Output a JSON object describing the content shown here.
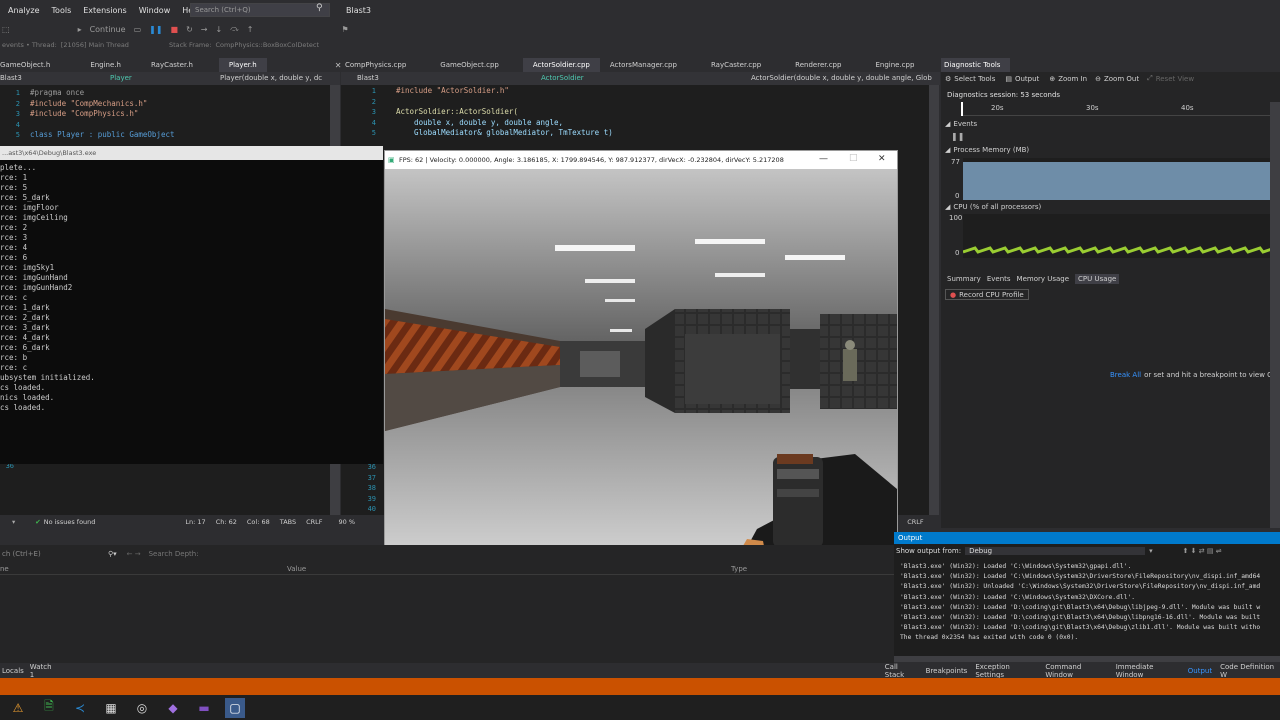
{
  "menu": {
    "items": [
      "Analyze",
      "Tools",
      "Extensions",
      "Window",
      "Help"
    ],
    "search_placeholder": "Search (Ctrl+Q)",
    "solution": "Blast3"
  },
  "toolbar": {
    "continue": "Continue",
    "thread_label": "events • Thread:",
    "thread": "[21056] Main Thread",
    "stack_frame_label": "Stack Frame:",
    "stack_frame": "CompPhysics::BoxBoxColDetect"
  },
  "left_editor": {
    "tabs": [
      "GameObject.h",
      "Engine.h",
      "RayCaster.h",
      "Player.h"
    ],
    "nav_project": "Blast3",
    "nav_class": "Player",
    "nav_member": "Player(double x, double y, dc",
    "lines": [
      {
        "n": "1",
        "t": "#pragma once"
      },
      {
        "n": "2",
        "t": "#include \"CompMechanics.h\""
      },
      {
        "n": "3",
        "t": "#include \"CompPhysics.h\""
      },
      {
        "n": "4",
        "t": ""
      },
      {
        "n": "5",
        "t": "class Player : public GameObject"
      }
    ],
    "bottom_lines": [
      "36"
    ]
  },
  "right_editor": {
    "tabs": [
      "CompPhysics.cpp",
      "GameObject.cpp",
      "ActorSoldier.cpp",
      "ActorsManager.cpp",
      "RayCaster.cpp",
      "Renderer.cpp",
      "Engine.cpp"
    ],
    "nav_project": "Blast3",
    "nav_class": "ActorSoldier",
    "nav_member": "ActorSoldier(double x, double y, double angle, Glob",
    "lines": [
      {
        "n": "1",
        "t": "#include \"ActorSoldier.h\""
      },
      {
        "n": "2",
        "t": ""
      },
      {
        "n": "3",
        "t": "ActorSoldier::ActorSoldier("
      },
      {
        "n": "4",
        "t": "    double x, double y, double angle,"
      },
      {
        "n": "5",
        "t": "    GlobalMediator& globalMediator, TmTexture t)"
      }
    ],
    "bottom_lines": [
      "36",
      "37",
      "38",
      "39",
      "40"
    ]
  },
  "console": {
    "title": "...ast3\\x64\\Debug\\Blast3.exe",
    "lines": [
      "plete...",
      "rce: 1",
      "rce: 5",
      "rce: 5_dark",
      "rce: imgFloor",
      "rce: imgCeiling",
      "rce: 2",
      "rce: 3",
      "rce: 4",
      "rce: 6",
      "rce: imgSky1",
      "rce: imgGunHand",
      "rce: imgGunHand2",
      "rce: c",
      "rce: 1_dark",
      "rce: 2_dark",
      "rce: 3_dark",
      "rce: 4_dark",
      "rce: 6_dark",
      "rce: b",
      "rce: c",
      "ubsystem initialized.",
      "cs loaded.",
      "nics loaded.",
      "cs loaded."
    ]
  },
  "game_window": {
    "title": "FPS: 62 | Velocity: 0.000000, Angle: 3.186185, X: 1799.894546, Y: 987.912377, dirVecX: -0.232804, dirVecY: 5.217208",
    "minimize": "—",
    "maximize": "□",
    "close": "✕"
  },
  "status": {
    "no_issues": "No issues found",
    "ln": "Ln: 17",
    "ch": "Ch: 62",
    "col": "Col: 68",
    "tabs": "TABS",
    "crlf": "CRLF",
    "zoom": "90 %",
    "crlf_right": "CRLF",
    "s_right": "S"
  },
  "diagnostics": {
    "title": "Diagnostic Tools",
    "select_tools": "Select Tools",
    "output": "Output",
    "zoom_in": "Zoom In",
    "zoom_out": "Zoom Out",
    "reset_view": "Reset View",
    "session": "Diagnostics session: 53 seconds",
    "ticks": [
      "20s",
      "30s",
      "40s"
    ],
    "events": "Events",
    "process_memory": "Process Memory (MB)",
    "mem_max": "77",
    "mem_min": "0",
    "cpu_title": "CPU (% of all processors)",
    "cpu_max": "100",
    "cpu_min": "0",
    "tabs": [
      "Summary",
      "Events",
      "Memory Usage",
      "CPU Usage"
    ],
    "record": "Record CPU Profile",
    "break_all": "Break All",
    "hint": "or set and hit a breakpoint to view CPU Us"
  },
  "watch": {
    "search_placeholder": "ch (Ctrl+E)",
    "search_depth": "Search Depth:",
    "col_name": "ne",
    "col_value": "Value",
    "col_type": "Type",
    "tabs": [
      "Locals",
      "Watch 1"
    ]
  },
  "output_panel": {
    "title": "Output",
    "show_from_label": "Show output from:",
    "show_from": "Debug",
    "lines": [
      "'Blast3.exe' (Win32): Loaded 'C:\\Windows\\System32\\gpapi.dll'.",
      "'Blast3.exe' (Win32): Loaded 'C:\\Windows\\System32\\DriverStore\\FileRepository\\nv_dispi.inf_amd64",
      "'Blast3.exe' (Win32): Unloaded 'C:\\Windows\\System32\\DriverStore\\FileRepository\\nv_dispi.inf_amd",
      "'Blast3.exe' (Win32): Loaded 'C:\\Windows\\System32\\DXCore.dll'.",
      "'Blast3.exe' (Win32): Loaded 'D:\\coding\\git\\Blast3\\x64\\Debug\\libjpeg-9.dll'. Module was built w",
      "'Blast3.exe' (Win32): Loaded 'D:\\coding\\git\\Blast3\\x64\\Debug\\libpng16-16.dll'. Module was built",
      "'Blast3.exe' (Win32): Loaded 'D:\\coding\\git\\Blast3\\x64\\Debug\\zlib1.dll'. Module was built witho",
      "The thread 0x2354 has exited with code 0 (0x0)."
    ]
  },
  "bottom_tabs": [
    "Call Stack",
    "Breakpoints",
    "Exception Settings",
    "Command Window",
    "Immediate Window",
    "Output",
    "Code Definition W"
  ],
  "colors": {
    "accent": "#007acc",
    "orange": "#ca5100",
    "cpu": "#9acd32",
    "memory": "#6e8da8"
  }
}
